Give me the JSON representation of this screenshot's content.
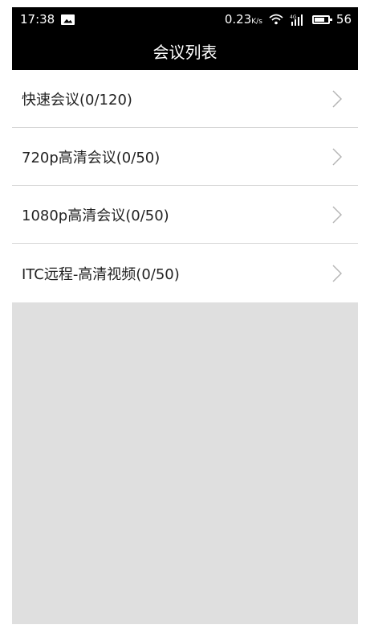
{
  "status_bar": {
    "time": "17:38",
    "speed": "0.23",
    "speed_unit": "K/s",
    "network": "4G",
    "battery": "56"
  },
  "header": {
    "title": "会议列表"
  },
  "meetings": [
    {
      "label": "快速会议(0/120)"
    },
    {
      "label": "720p高清会议(0/50)"
    },
    {
      "label": "1080p高清会议(0/50)"
    },
    {
      "label": "ITC远程-高清视频(0/50)"
    }
  ],
  "icons": {
    "image": "image-icon",
    "wifi": "wifi-icon",
    "signal": "signal-icon",
    "battery": "battery-icon",
    "chevron": "chevron-right-icon"
  }
}
